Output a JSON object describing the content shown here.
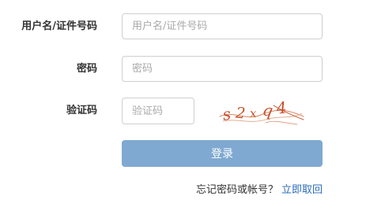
{
  "form": {
    "username": {
      "label": "用户名/证件号码",
      "placeholder": "用户名/证件号码",
      "value": ""
    },
    "password": {
      "label": "密码",
      "placeholder": "密码",
      "value": ""
    },
    "captcha": {
      "label": "验证码",
      "placeholder": "验证码",
      "value": "",
      "image_text": "s2xq4"
    },
    "login_button": "登录",
    "forgot_text": "忘记密码或帐号？",
    "retrieve_link": "立即取回"
  },
  "colors": {
    "button_bg": "#7fa9d1",
    "link": "#2b6cb8",
    "captcha_ink": "#c4502a"
  }
}
